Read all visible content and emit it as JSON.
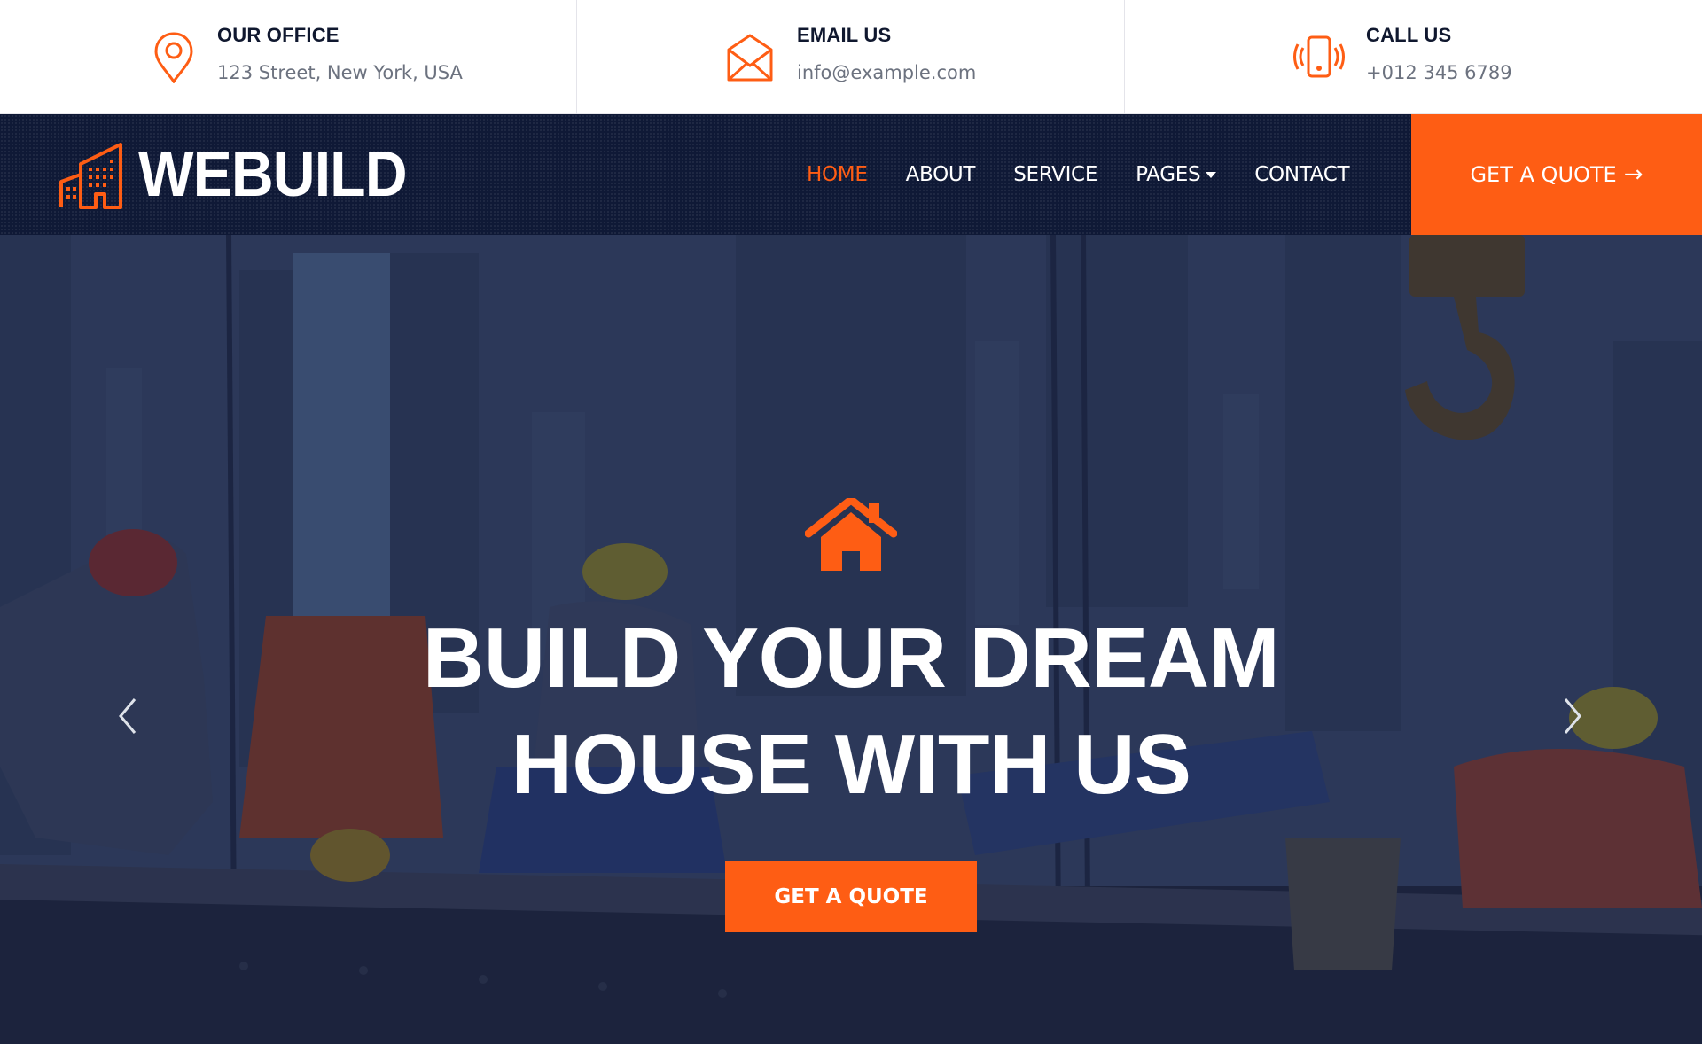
{
  "topbar": {
    "items": [
      {
        "icon": "map-pin-icon",
        "title": "OUR OFFICE",
        "value": "123 Street, New York, USA"
      },
      {
        "icon": "envelope-open-icon",
        "title": "EMAIL US",
        "value": "info@example.com"
      },
      {
        "icon": "phone-vibrate-icon",
        "title": "CALL US",
        "value": "+012 345 6789"
      }
    ]
  },
  "navbar": {
    "brand": "WEBUILD",
    "items": [
      {
        "label": "HOME",
        "active": true
      },
      {
        "label": "ABOUT"
      },
      {
        "label": "SERVICE"
      },
      {
        "label": "PAGES",
        "dropdown": true
      },
      {
        "label": "CONTACT"
      }
    ],
    "quote_button": {
      "label": "GET A QUOTE",
      "arrow": "→"
    }
  },
  "hero": {
    "icon": "house-icon",
    "headline_line1": "BUILD YOUR DREAM",
    "headline_line2": "HOUSE WITH US",
    "cta_label": "GET A QUOTE",
    "prev_label": "Previous",
    "next_label": "Next"
  },
  "colors": {
    "accent": "#fe5d14",
    "navy": "#0f1936",
    "heading": "#10182f",
    "muted_text": "#6c727f"
  }
}
